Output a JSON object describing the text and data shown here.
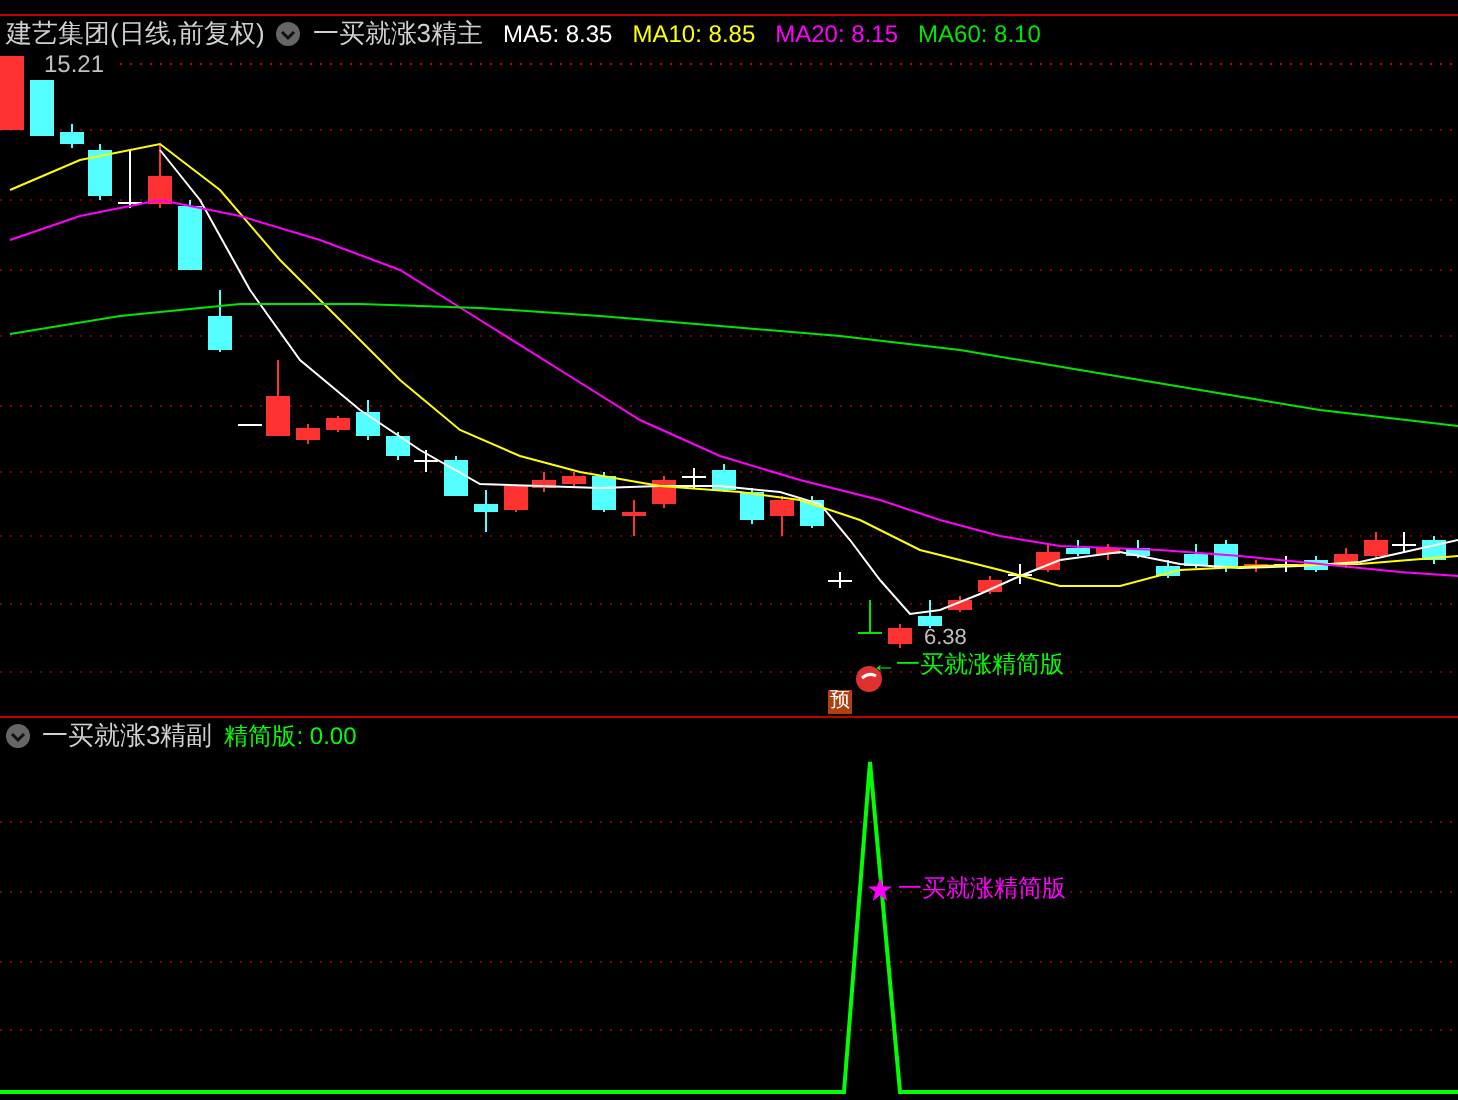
{
  "header": {
    "stock_title": "建艺集团(日线,前复权)",
    "indicator_name": "一买就涨3精主",
    "ma": [
      {
        "label": "MA5:",
        "value": "8.35",
        "color": "#ffffff"
      },
      {
        "label": "MA10:",
        "value": "8.85",
        "color": "#ffff00"
      },
      {
        "label": "MA20:",
        "value": "8.15",
        "color": "#ff00ff"
      },
      {
        "label": "MA60:",
        "value": "8.10",
        "color": "#00e600"
      }
    ]
  },
  "main_chart": {
    "high_label": "15.21",
    "low_label": "6.38",
    "signal_text": "←一买就涨精简版",
    "forecast_badge": "预"
  },
  "sub_panel": {
    "indicator_name": "一买就涨3精副",
    "value_label": "精简版:",
    "value": "0.00",
    "signal_text": "一买就涨精简版"
  }
}
